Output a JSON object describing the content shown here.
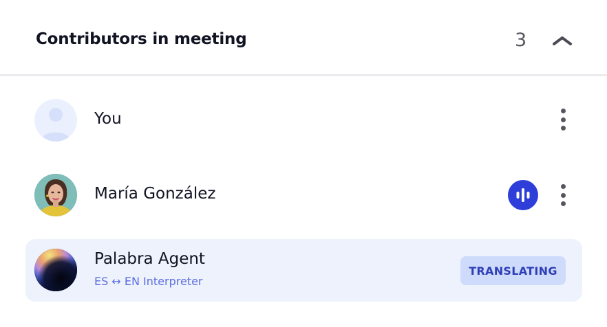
{
  "header": {
    "title": "Contributors in meeting",
    "count": "3"
  },
  "participants": [
    {
      "name": "You"
    },
    {
      "name": "María González"
    },
    {
      "name": "Palabra Agent",
      "subtitle": "ES ↔ EN Interpreter",
      "status": "TRANSLATING"
    }
  ],
  "icons": {
    "collapse": "chevron-up-icon",
    "menu": "more-vertical-icon",
    "speaking": "audio-waveform-icon",
    "placeholder_avatar": "user-silhouette-icon"
  },
  "colors": {
    "accent": "#2d3fd8",
    "agent_card_bg": "#eef2fd",
    "badge_bg": "#cfdbfb",
    "badge_text": "#2e3fb6",
    "subtitle_text": "#5a6de0"
  }
}
